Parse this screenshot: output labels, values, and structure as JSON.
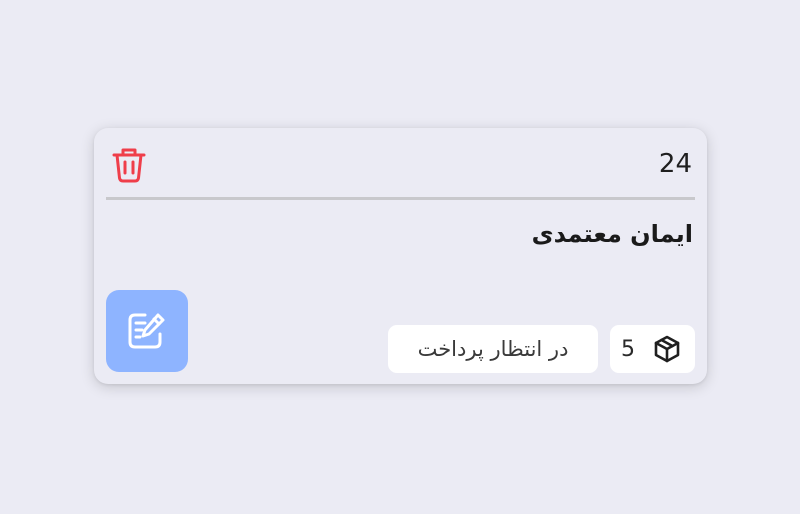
{
  "order": {
    "id": "24",
    "customer_name": "ایمان معتمدی",
    "quantity": "5",
    "status": "در انتظار پرداخت"
  },
  "icons": {
    "delete": "trash-icon",
    "edit": "edit-note-icon",
    "quantity": "package-icon"
  },
  "colors": {
    "delete_icon": "#ef3e4a",
    "edit_button_bg": "#8eb4ff",
    "page_bg": "#ebebf4"
  }
}
